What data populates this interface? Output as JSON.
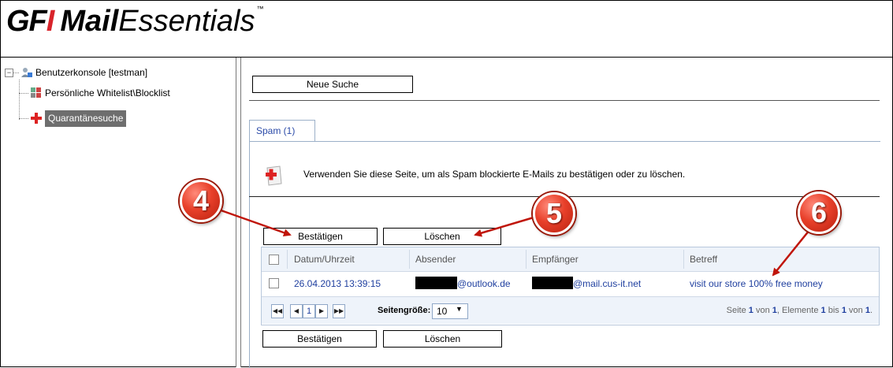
{
  "logo": {
    "part1": "GF",
    "part1_i": "I",
    "part2": "Mail",
    "part3": "Essentials",
    "tm": "™"
  },
  "tree": {
    "root": "Benutzerkonsole [testman]",
    "items": [
      {
        "label": "Persönliche Whitelist\\Blocklist"
      },
      {
        "label": "Quarantänesuche",
        "selected": true
      }
    ]
  },
  "toolbar": {
    "new_search": "Neue Suche"
  },
  "tab": {
    "label": "Spam (1)"
  },
  "info": {
    "text": "Verwenden Sie diese Seite, um als Spam blockierte E-Mails zu bestätigen oder zu löschen."
  },
  "actions": {
    "confirm": "Bestätigen",
    "delete": "Löschen"
  },
  "grid": {
    "columns": [
      "Datum/Uhrzeit",
      "Absender",
      "Empfänger",
      "Betreff"
    ],
    "rows": [
      {
        "date": "26.04.2013 13:39:15",
        "sender": "@outlook.de",
        "recipient": "@mail.cus-it.net",
        "subject": "visit our store 100% free money"
      }
    ]
  },
  "pager": {
    "current_page": "1",
    "page_size_label": "Seitengröße:",
    "page_size": "10",
    "summary": {
      "p1": "Seite ",
      "page": "1",
      "p2": " von ",
      "pages": "1",
      "p3": ", Elemente ",
      "from": "1",
      "p4": " bis ",
      "to": "1",
      "p5": " von ",
      "total": "1",
      "p6": "."
    }
  },
  "callouts": [
    "4",
    "5",
    "6"
  ],
  "colors": {
    "accent_link": "#1f3f9f",
    "badge_red": "#e8402a",
    "logo_red": "#d8232a"
  }
}
